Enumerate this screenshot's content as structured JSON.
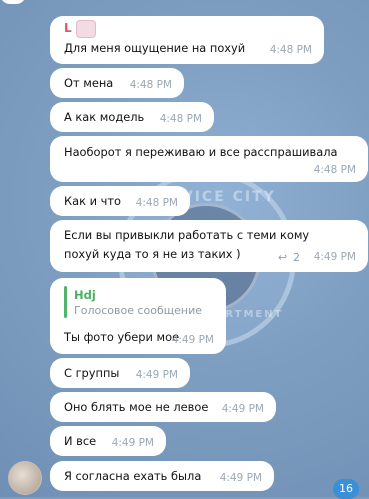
{
  "chat": {
    "messages": [
      {
        "author": "L",
        "text": "Для меня ощущение на похуй",
        "time": "4:48 PM"
      },
      {
        "text": "От мена",
        "time": "4:48 PM"
      },
      {
        "text": "А как модель",
        "time": "4:48 PM"
      },
      {
        "text": "Наоборот я переживаю и все расспрашивала",
        "time": "4:48 PM"
      },
      {
        "text": "Как и что",
        "time": "4:48 PM"
      },
      {
        "text_line1": "Если вы привыкли работать с теми кому",
        "text_line2": "похуй куда то я не из таких )",
        "replies": "2",
        "time": "4:49 PM"
      },
      {
        "quote_name": "Hdj",
        "quote_text": "Голосовое сообщение",
        "text": "Ты фото убери мое",
        "time": "4:49 PM"
      },
      {
        "text": "С группы",
        "time": "4:49 PM"
      },
      {
        "text": "Оно блять мое не левое",
        "time": "4:49 PM"
      },
      {
        "text": "И все",
        "time": "4:49 PM"
      },
      {
        "text": "Я согласна ехать была",
        "time": "4:49 PM"
      }
    ],
    "unread_count": "16"
  },
  "wallpaper": {
    "watermark_text": "THE VICE CITY",
    "watermark_bottom": "POLICE DEPARTMENT"
  },
  "icons": {
    "reply": "reply-icon",
    "avatar": "avatar"
  },
  "colors": {
    "background": "#7d9bbd",
    "bubble": "#ffffff",
    "author": "#d85a6a",
    "quote": "#4caf62",
    "badge": "#3a8fd6"
  }
}
